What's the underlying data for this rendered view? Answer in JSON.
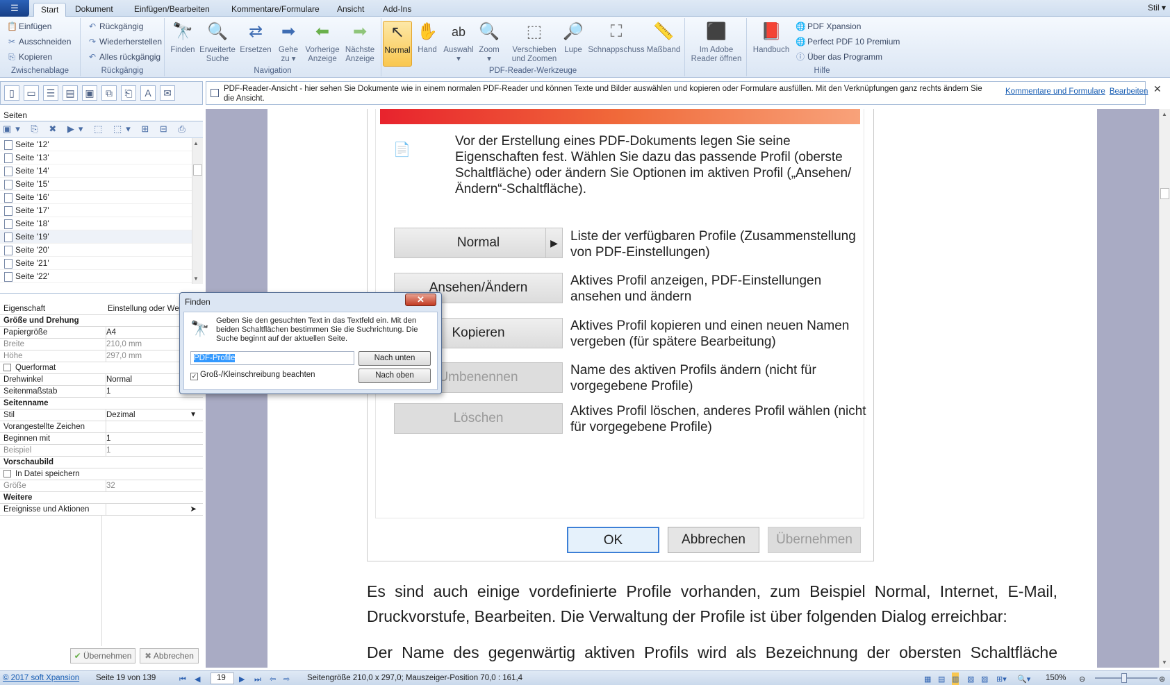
{
  "ribbon": {
    "app_button": "☰",
    "tabs": [
      "Start",
      "Dokument",
      "Einfügen/Bearbeiten",
      "Kommentare/Formulare",
      "Ansicht",
      "Add-Ins"
    ],
    "style_menu": "Stil",
    "clipboard": {
      "paste": "Einfügen",
      "cut": "Ausschneiden",
      "copy": "Kopieren",
      "label": "Zwischenablage"
    },
    "undo": {
      "undo": "Rückgängig",
      "redo": "Wiederherstellen",
      "undo_all": "Alles rückgängig",
      "label": "Rückgängig"
    },
    "navigation": {
      "find": "Finden",
      "advanced_search": "Erweiterte\nSuche",
      "replace": "Ersetzen",
      "goto": "Gehe\nzu ▾",
      "previous": "Vorherige\nAnzeige",
      "next": "Nächste\nAnzeige",
      "label": "Navigation"
    },
    "tools": {
      "normal": "Normal",
      "hand": "Hand",
      "select": "Auswahl\n▾",
      "zoom": "Zoom\n▾",
      "pan_zoom": "Verschieben\nund Zoomen",
      "magnifier": "Lupe",
      "snapshot": "Schnappschuss",
      "ruler": "Maßband",
      "label": "PDF-Reader-Werkzeuge"
    },
    "adobe": {
      "open": "Im Adobe\nReader öffnen"
    },
    "help": {
      "manual": "Handbuch",
      "xpansion": "PDF Xpansion",
      "perfect": "Perfect PDF 10 Premium",
      "about": "Über das Programm",
      "label": "Hilfe"
    }
  },
  "infobar": {
    "text": "PDF-Reader-Ansicht - hier sehen Sie Dokumente wie in einem normalen PDF-Reader und können Texte und Bilder auswählen und kopieren oder Formulare ausfüllen. Mit den Verknüpfungen ganz rechts ändern Sie die Ansicht.",
    "link_comments": "Kommentare und Formulare",
    "link_edit": "Bearbeiten",
    "close": "✕"
  },
  "pages_panel": {
    "title": "Seiten",
    "toolbar": "▣▾ ⎘ ✖ ▶▾ ⬚ ⬚▾ ⊞ ⊟ ⎙ ⚙▾",
    "items": [
      "Seite '12'",
      "Seite '13'",
      "Seite '14'",
      "Seite '15'",
      "Seite '16'",
      "Seite '17'",
      "Seite '18'",
      "Seite '19'",
      "Seite '20'",
      "Seite '21'",
      "Seite '22'"
    ],
    "selected_index": 7
  },
  "properties": {
    "header_key": "Eigenschaft",
    "header_value": "Einstellung oder Wert",
    "section_size": "Größe und Drehung",
    "paper_size_k": "Papiergröße",
    "paper_size_v": "A4",
    "width_k": "Breite",
    "width_v": "210,0 mm",
    "height_k": "Höhe",
    "height_v": "297,0 mm",
    "landscape": "Querformat",
    "rotation_k": "Drehwinkel",
    "rotation_v": "Normal",
    "scale_k": "Seitenmaßstab",
    "scale_v": "1",
    "section_name": "Seitenname",
    "style_k": "Stil",
    "style_v": "Dezimal",
    "prefix_k": "Vorangestellte Zeichen",
    "prefix_v": "",
    "start_k": "Beginnen mit",
    "start_v": "1",
    "example_k": "Beispiel",
    "example_v": "1",
    "section_preview": "Vorschaubild",
    "save_in_file": "In Datei speichern",
    "size_k": "Größe",
    "size_v": "32",
    "section_more": "Weitere",
    "events_k": "Ereignisse und Aktionen",
    "apply": "Übernehmen",
    "cancel": "Abbrechen"
  },
  "document": {
    "intro": "Vor der Erstellung eines PDF-Dokuments legen Sie seine Eigenschaften fest. Wählen Sie dazu das passende Profil (oberste Schaltfläche) oder ändern Sie Optionen im aktiven Profil („Ansehen/Ändern“-Schaltfläche).",
    "buttons": [
      {
        "label": "Normal",
        "desc": "Liste der verfügbaren Profile (Zusammenstellung von PDF-Einstellungen)"
      },
      {
        "label": "Ansehen/Ändern",
        "desc": "Aktives Profil anzeigen, PDF-Einstellungen ansehen und ändern"
      },
      {
        "label": "Kopieren",
        "desc": "Aktives Profil kopieren und einen neuen Namen vergeben (für spätere Bearbeitung)"
      },
      {
        "label": "Umbenennen",
        "desc": "Name des aktiven Profils ändern (nicht für vorgegebene Profile)"
      },
      {
        "label": "Löschen",
        "desc": "Aktives Profil löschen, anderes Profil wählen (nicht für vorgegebene Profile)"
      }
    ],
    "ok": "OK",
    "cancel": "Abbrechen",
    "apply": "Übernehmen",
    "para1": "Es sind auch einige vordefinierte Profile vorhanden, zum Beispiel Normal, Internet, E-Mail, Druckvorstufe, Bearbeiten. Die Verwaltung der Profile ist über folgenden Dialog erreichbar:",
    "para2": "Der Name des gegenwärtig aktiven Profils wird als Bezeichnung der obersten Schaltfläche"
  },
  "find_dialog": {
    "title": "Finden",
    "close": "✕",
    "instructions": "Geben Sie den gesuchten Text in das Textfeld ein. Mit den beiden Schaltflächen bestimmen Sie die Suchrichtung. Die Suche beginnt auf der aktuellen Seite.",
    "search_value": "PDF-Profile",
    "match_case": "Groß-/Kleinschreibung beachten",
    "match_case_checked": true,
    "down": "Nach unten",
    "up": "Nach oben"
  },
  "statusbar": {
    "copyright": "© 2017 soft Xpansion",
    "page_info": "Seite 19 von 139",
    "page_input": "19",
    "page_size": "Seitengröße 210,0 x 297,0;  Mauszeiger-Position 70,0 : 161,4",
    "zoom": "150%"
  },
  "colors": {
    "accent": "#1a5fb4",
    "ribbon": "#dbe6f4",
    "doc_bg": "#a9abc4",
    "selected_tool": "#f9c74f"
  }
}
